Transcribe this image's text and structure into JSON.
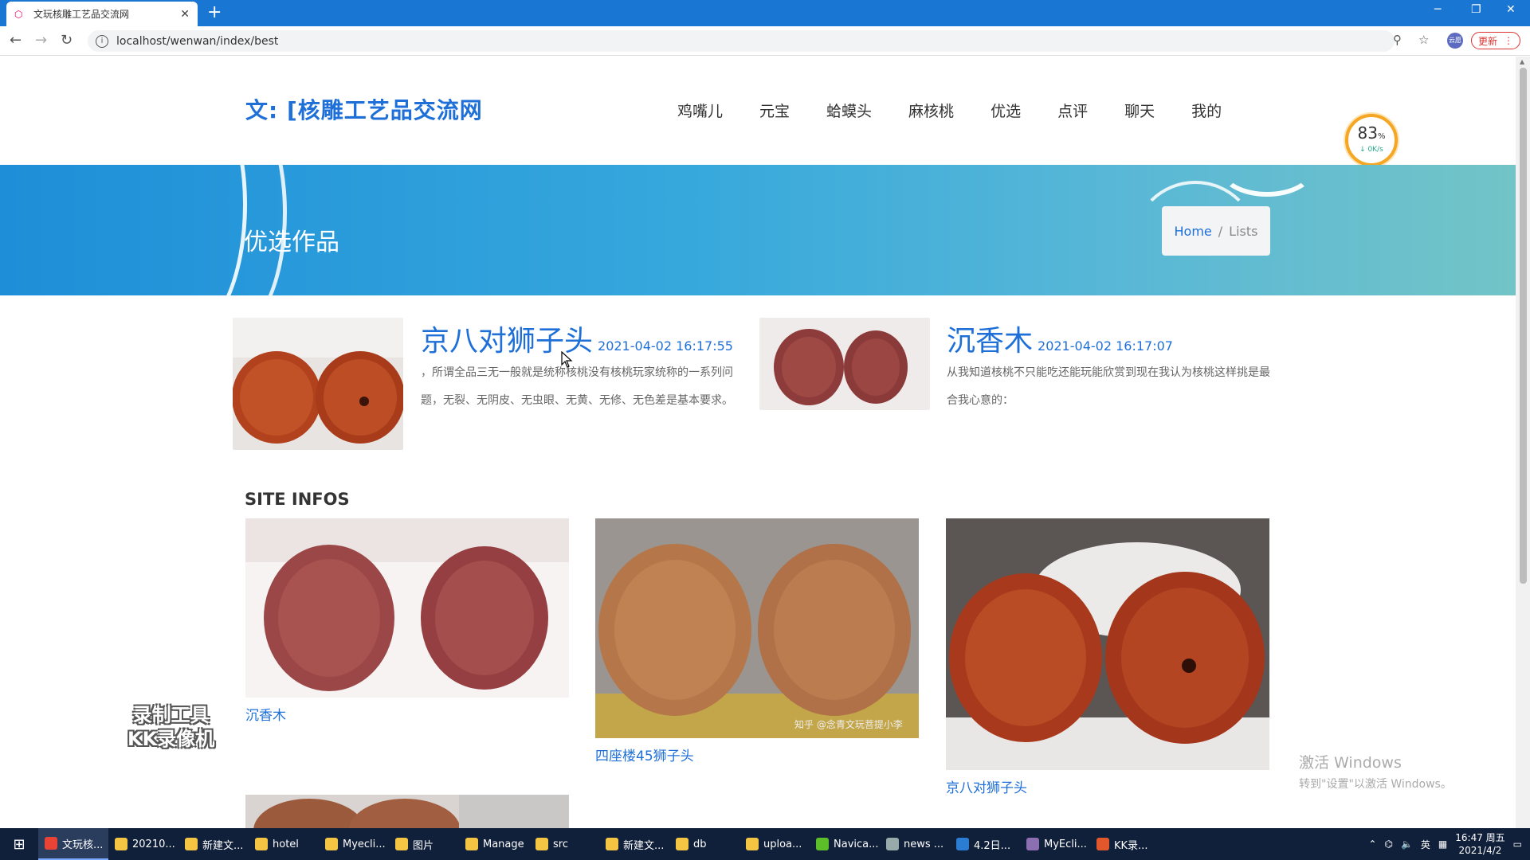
{
  "browser": {
    "tab_title": "文玩核雕工艺品交流网",
    "new_tab": "+",
    "tab_close": "✕",
    "window_minimize": "─",
    "window_restore": "❐",
    "window_close": "✕",
    "url": "localhost/wenwan/index/best",
    "profile_label": "云愿",
    "update_label": "更新"
  },
  "site": {
    "logo": "文: [核雕工艺品交流网",
    "nav": [
      "鸡嘴儿",
      "元宝",
      "蛤蟆头",
      "麻核桃",
      "优选",
      "点评",
      "聊天",
      "我的"
    ],
    "speed_percent": "83",
    "speed_unit": "%",
    "speed_rate": "↓ 0K/s"
  },
  "banner": {
    "title": "优选作品",
    "breadcrumb_home": "Home",
    "breadcrumb_sep": "/",
    "breadcrumb_current": "Lists"
  },
  "featured": [
    {
      "name": "京八对狮子头",
      "date": "2021-04-02 16:17:55",
      "desc": "，所谓全品三无一般就是统称核桃没有核桃玩家统称的一系列问题，无裂、无阴皮、无虫眼、无黄、无修、无色差是基本要求。"
    },
    {
      "name": "沉香木",
      "date": "2021-04-02 16:17:07",
      "desc": "从我知道核桃不只能吃还能玩能欣赏到现在我认为核桃这样挑是最合我心意的："
    }
  ],
  "site_infos": {
    "heading": "SITE INFOS",
    "cards": [
      {
        "caption": "沉香木"
      },
      {
        "caption": "四座楼45狮子头",
        "watermark": "知乎 @念青文玩菩提小李"
      },
      {
        "caption": "京八对狮子头"
      }
    ]
  },
  "overlays": {
    "recorder_line1": "录制工具",
    "recorder_line2": "KK录像机",
    "activate_line1": "激活 Windows",
    "activate_line2": "转到\"设置\"以激活 Windows。"
  },
  "taskbar": {
    "items": [
      {
        "label": "文玩核...",
        "color": "#e94335"
      },
      {
        "label": "20210...",
        "color": "#f4c542"
      },
      {
        "label": "新建文...",
        "color": "#f4c542"
      },
      {
        "label": "hotel",
        "color": "#f4c542"
      },
      {
        "label": "Myecli...",
        "color": "#f4c542"
      },
      {
        "label": "图片",
        "color": "#f4c542"
      },
      {
        "label": "Manage",
        "color": "#f4c542"
      },
      {
        "label": "src",
        "color": "#f4c542"
      },
      {
        "label": "新建文...",
        "color": "#f4c542"
      },
      {
        "label": "db",
        "color": "#f4c542"
      },
      {
        "label": "uploa...",
        "color": "#f4c542"
      },
      {
        "label": "Navica...",
        "color": "#5cbf2a"
      },
      {
        "label": "news ...",
        "color": "#9aa"
      },
      {
        "label": "4.2日...",
        "color": "#2b7cd3"
      },
      {
        "label": "MyEcli...",
        "color": "#8b6fb0"
      },
      {
        "label": "KK录...",
        "color": "#e2572b"
      }
    ],
    "ime": "英",
    "time": "16:47 周五",
    "date": "2021/4/2"
  }
}
